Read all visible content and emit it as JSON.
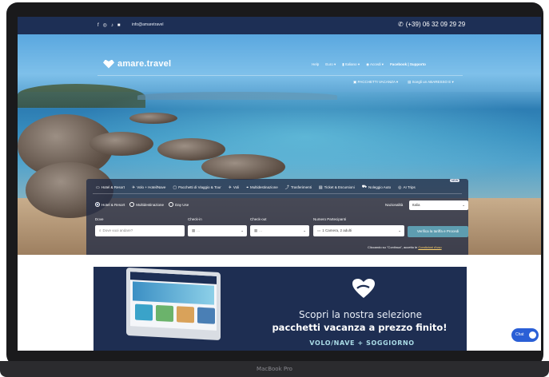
{
  "topbar": {
    "social": [
      "f",
      "◎",
      "♪",
      "■"
    ],
    "email": "info@amaretravel",
    "phone": "(+39) 06 32 09 29 29"
  },
  "header": {
    "logo": "amare.travel",
    "nav": [
      "Help",
      "Euro",
      "Italiano",
      "Accedi",
      "Facebook | Supporto"
    ],
    "subnav": [
      "PACCHETTI VACANZA",
      "Scegli un ABARESSO E"
    ]
  },
  "search": {
    "tabs": [
      "Hotel & Resort",
      "Volo + Hotel/Nave",
      "Pacchetti di Viaggio & Tour",
      "Voli",
      "Multidestinazione",
      "Trasferimenti",
      "Ticket & Escursioni",
      "Noleggio Auto",
      "AI Trips"
    ],
    "new_badge": "NEW",
    "radios": [
      "Hotel & Resort",
      "Multidestinazione",
      "Day Use"
    ],
    "nationality_label": "Nazionalità",
    "nationality_value": "Italia",
    "dove_label": "Dove",
    "dove_placeholder": "Dove vuoi andare?",
    "checkin_label": "Check-in",
    "checkin_value": "...",
    "checkout_label": "Check-out",
    "checkout_value": "...",
    "partecipanti_label": "Numero Partecipanti",
    "partecipanti_value": "1 Camera, 2 adulti",
    "verify_button": "Verifica la tariffa e Procedi",
    "terms_text": "Cliccando su \"Continua\", accetto le",
    "terms_link": "Condizioni d'uso"
  },
  "banner": {
    "line1": "Scopri la nostra selezione",
    "line2": "pacchetti vacanza a prezzo finito!",
    "line3": "VOLO/NAVE + SOGGIORNO"
  },
  "chat": {
    "label": "Chat"
  },
  "device_label": "MacBook Pro",
  "colors": {
    "navy": "#1d2f55",
    "accent": "#5e9db0",
    "chat": "#2a5fd6"
  }
}
